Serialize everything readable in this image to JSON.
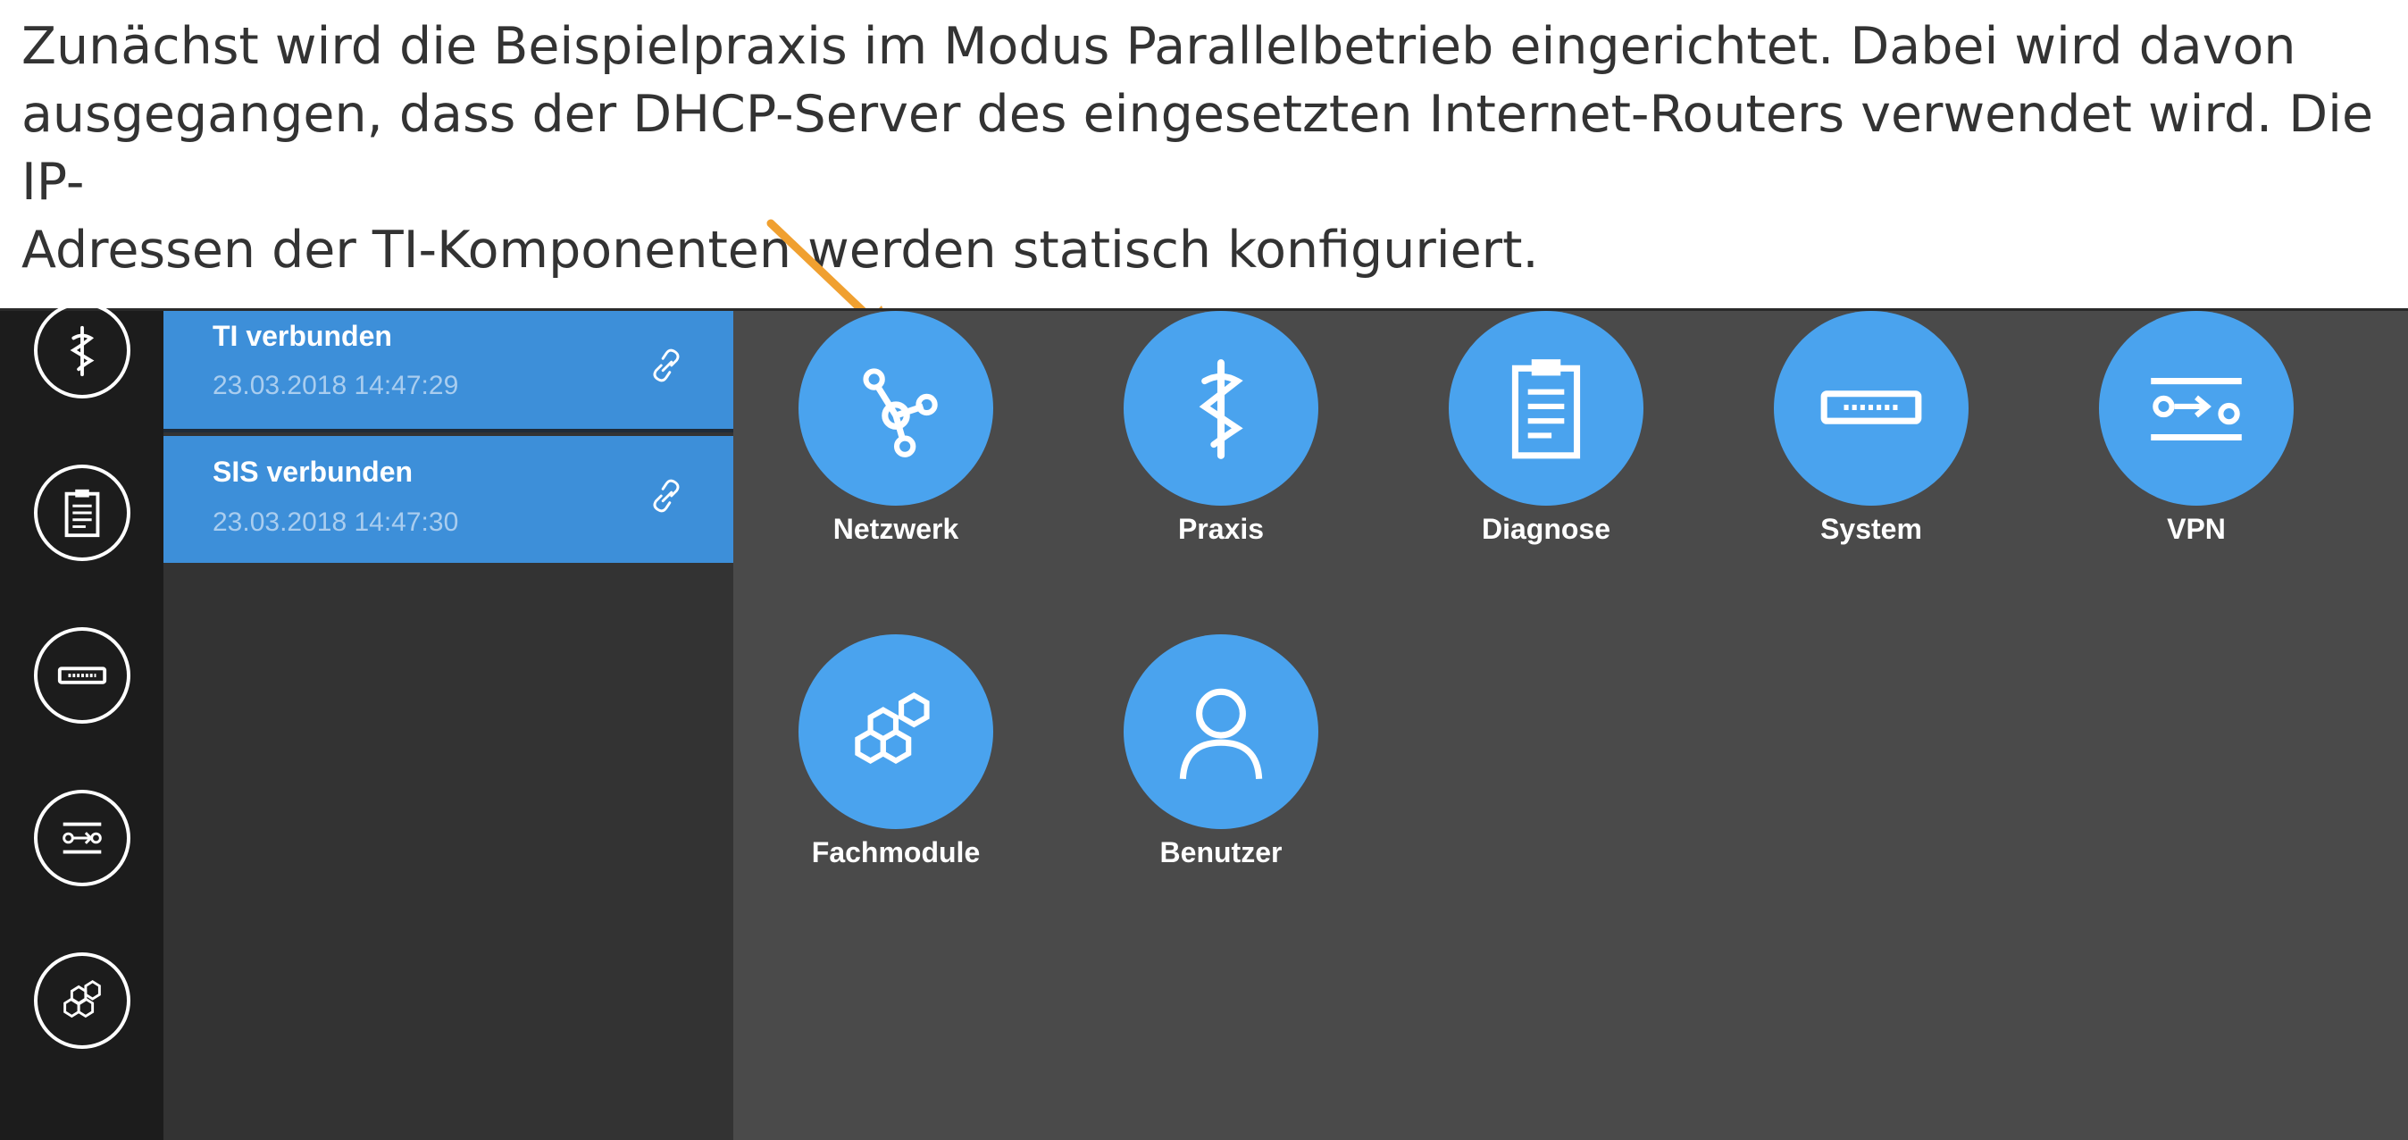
{
  "caption": {
    "line1": "Zunächst wird die Beispielpraxis im Modus Parallelbetrieb eingerichtet. Dabei wird davon",
    "line2": "ausgegangen, dass der DHCP-Server des eingesetzten Internet-Routers verwendet wird. Die IP-",
    "line3": "Adressen der TI-Komponenten werden statisch konfiguriert."
  },
  "colors": {
    "accent": "#4aa3ee",
    "status_bg": "#3d8fd9",
    "arrow": "#f0a030",
    "screen_bg": "#4a4a4a",
    "rail_bg": "#1c1c1c"
  },
  "rail": {
    "items": [
      {
        "icon": "caduceus-icon"
      },
      {
        "icon": "clipboard-icon"
      },
      {
        "icon": "device-icon"
      },
      {
        "icon": "vpn-switch-icon"
      },
      {
        "icon": "hexagons-icon"
      }
    ]
  },
  "status": {
    "items": [
      {
        "title": "TI verbunden",
        "time": "23.03.2018 14:47:29",
        "icon": "link-icon"
      },
      {
        "title": "SIS verbunden",
        "time": "23.03.2018 14:47:30",
        "icon": "link-icon"
      }
    ]
  },
  "tiles": [
    {
      "label": "Netzwerk",
      "icon": "network-icon"
    },
    {
      "label": "Praxis",
      "icon": "caduceus-icon"
    },
    {
      "label": "Diagnose",
      "icon": "clipboard-icon"
    },
    {
      "label": "System",
      "icon": "device-icon"
    },
    {
      "label": "VPN",
      "icon": "vpn-switch-icon"
    },
    {
      "label": "Fachmodule",
      "icon": "hexagons-icon"
    },
    {
      "label": "Benutzer",
      "icon": "user-icon"
    }
  ]
}
